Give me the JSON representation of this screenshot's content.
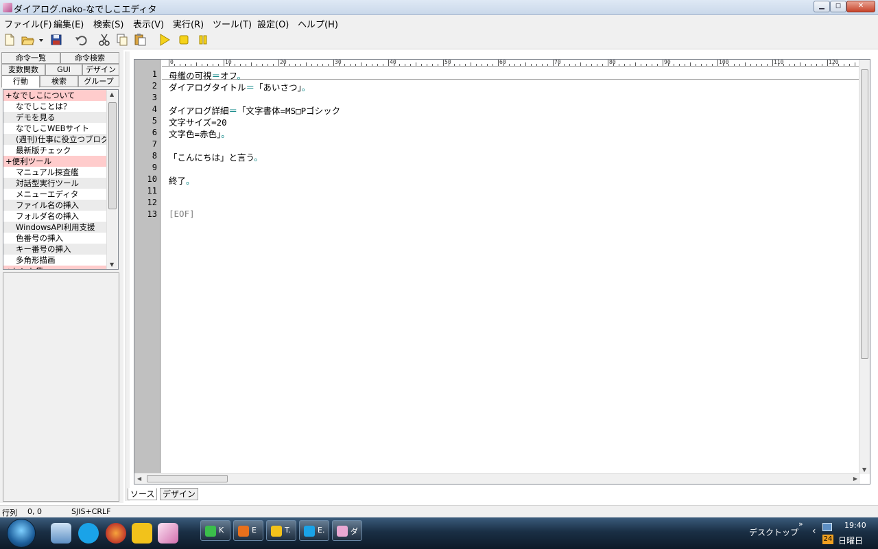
{
  "window": {
    "title": "ダイアログ.nako-なでしこエディタ",
    "min_glyph": "▁",
    "max_glyph": "◻",
    "close_glyph": "✕"
  },
  "menu": [
    "ファイル(F)",
    "編集(E)",
    "検索(S)",
    "表示(V)",
    "実行(R)",
    "ツール(T)",
    "設定(O)",
    "ヘルプ(H)"
  ],
  "toolbar": [
    "new-file-icon",
    "open-folder-icon",
    "save-icon",
    "undo-icon",
    "cut-icon",
    "copy-icon",
    "paste-icon",
    "run-icon",
    "stop-icon",
    "pause-icon"
  ],
  "left_tabs": {
    "row1": [
      "命令一覧",
      "命令検索"
    ],
    "row2": [
      "変数関数",
      "GUI",
      "デザイン"
    ],
    "row3": [
      "行動",
      "検索",
      "グループ"
    ]
  },
  "action_list": [
    {
      "label": "+なでしこについて",
      "kind": "cat"
    },
    {
      "label": "なでしことは？",
      "kind": "item"
    },
    {
      "label": "デモを見る",
      "kind": "alt"
    },
    {
      "label": "なでしこWEBサイト",
      "kind": "item"
    },
    {
      "label": "(週刊)仕事に役立つブログ",
      "kind": "alt"
    },
    {
      "label": "最新版チェック",
      "kind": "item"
    },
    {
      "label": "+便利ツール",
      "kind": "cat"
    },
    {
      "label": "マニュアル探査艦",
      "kind": "item"
    },
    {
      "label": "対話型実行ツール",
      "kind": "alt"
    },
    {
      "label": "メニューエディタ",
      "kind": "item"
    },
    {
      "label": "ファイル名の挿入",
      "kind": "alt"
    },
    {
      "label": "フォルダ名の挿入",
      "kind": "item"
    },
    {
      "label": "WindowsAPI利用支援",
      "kind": "alt"
    },
    {
      "label": "色番号の挿入",
      "kind": "item"
    },
    {
      "label": "キー番号の挿入",
      "kind": "alt"
    },
    {
      "label": "多角形描画",
      "kind": "item"
    },
    {
      "label": "+ヒント集",
      "kind": "cat"
    }
  ],
  "ruler_labels": [
    "0",
    "10",
    "20",
    "30",
    "40",
    "50",
    "60",
    "70",
    "80",
    "90",
    "100",
    "110",
    "120"
  ],
  "editor": {
    "line_numbers": [
      "1",
      "2",
      "3",
      "4",
      "5",
      "6",
      "7",
      "8",
      "9",
      "10",
      "11",
      "12",
      "13"
    ],
    "lines": {
      "l1a": "母艦の可視",
      "l1b": "＝",
      "l1c": "オフ",
      "l1d": "。",
      "l2a": "ダイアログタイトル",
      "l2b": "＝",
      "l2c": "「あいさつ」",
      "l2d": "。",
      "l4a": "ダイアログ詳細",
      "l4b": "＝",
      "l4c": "「文字書体=MS□Pゴシック",
      "l5": "文字サイズ=20",
      "l6a": "文字色=赤色」",
      "l6b": "。",
      "l8a": "「こんにちは」と言う",
      "l8b": "。",
      "l10a": "終了",
      "l10b": "。",
      "l13": "[EOF]"
    }
  },
  "bottom_tabs": [
    "ソース",
    "デザイン"
  ],
  "status": {
    "label": "行列",
    "position": "0, 0",
    "encoding": "SJIS+CRLF"
  },
  "taskbar": {
    "buttons": [
      {
        "text": "K",
        "icon": "gem-icon",
        "color": "#3bbf4b"
      },
      {
        "text": "E",
        "icon": "firefox-icon",
        "color": "#e8701c"
      },
      {
        "text": "T.",
        "icon": "mail-icon",
        "color": "#f2c21b"
      },
      {
        "text": "E.",
        "icon": "skype-icon",
        "color": "#1aa3e8"
      },
      {
        "text": "ダ",
        "icon": "nadesiko-icon",
        "color": "#e9a8d3"
      }
    ],
    "desktop_label": "デスクトップ",
    "chevron": "»",
    "arrow": "‹",
    "time": "19:40",
    "day": "日曜日",
    "date_badge": "24"
  }
}
